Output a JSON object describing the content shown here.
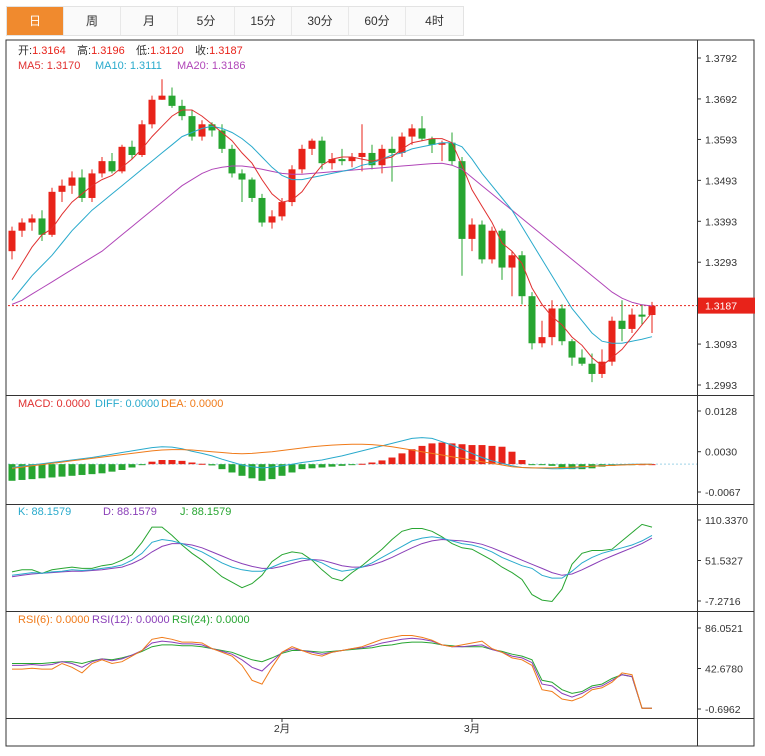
{
  "tabs": [
    {
      "label": "日",
      "active": true
    },
    {
      "label": "周"
    },
    {
      "label": "月"
    },
    {
      "label": "5分"
    },
    {
      "label": "15分"
    },
    {
      "label": "30分"
    },
    {
      "label": "60分"
    },
    {
      "label": "4时"
    }
  ],
  "colors": {
    "up": "#e8231a",
    "down": "#27a531",
    "ma5": "#e03030",
    "ma10": "#29aacc",
    "ma20": "#b045b8",
    "orange": "#f07b1a"
  },
  "main_legend": {
    "open_label": "开:",
    "open": "1.3164",
    "high_label": "高:",
    "high": "1.3196",
    "low_label": "低:",
    "low": "1.3120",
    "close_label": "收:",
    "close": "1.3187",
    "ma5": "MA5:  1.3170",
    "ma10": "MA10:  1.3111",
    "ma20": "MA20:  1.3186"
  },
  "macd_legend": {
    "macd": "MACD: 0.0000",
    "diff": "DIFF: 0.0000",
    "dea": "DEA: 0.0000"
  },
  "kdj_legend": {
    "k": "K: 88.1579",
    "d": "D: 88.1579",
    "j": "J: 88.1579"
  },
  "rsi_legend": {
    "rsi6": "RSI(6): 0.0000",
    "rsi12": "RSI(12): 0.0000",
    "rsi24": "RSI(24): 0.0000"
  },
  "price_marker": "1.3187",
  "x_labels": [
    {
      "label": "2月",
      "index": 27
    },
    {
      "label": "3月",
      "index": 46
    }
  ],
  "chart_data": [
    {
      "type": "candlestick",
      "y_ticks": [
        "1.3792",
        "1.3692",
        "1.3593",
        "1.3493",
        "1.3393",
        "1.3293",
        "1.3187",
        "1.3093",
        "1.2993"
      ],
      "ylim": [
        1.2973,
        1.3832
      ],
      "current_price": 1.3187,
      "candles": [
        [
          1.332,
          1.338,
          1.33,
          1.337
        ],
        [
          1.337,
          1.34,
          1.3355,
          1.339
        ],
        [
          1.339,
          1.341,
          1.337,
          1.34
        ],
        [
          1.34,
          1.342,
          1.3345,
          1.336
        ],
        [
          1.336,
          1.3475,
          1.3355,
          1.3465
        ],
        [
          1.3465,
          1.3495,
          1.344,
          1.348
        ],
        [
          1.348,
          1.3515,
          1.346,
          1.35
        ],
        [
          1.35,
          1.352,
          1.344,
          1.345
        ],
        [
          1.345,
          1.352,
          1.344,
          1.351
        ],
        [
          1.351,
          1.355,
          1.35,
          1.354
        ],
        [
          1.354,
          1.356,
          1.351,
          1.3515
        ],
        [
          1.3515,
          1.358,
          1.351,
          1.3575
        ],
        [
          1.3575,
          1.359,
          1.3545,
          1.3555
        ],
        [
          1.3555,
          1.364,
          1.355,
          1.363
        ],
        [
          1.363,
          1.37,
          1.362,
          1.369
        ],
        [
          1.369,
          1.374,
          1.369,
          1.37
        ],
        [
          1.37,
          1.372,
          1.367,
          1.3675
        ],
        [
          1.3675,
          1.369,
          1.364,
          1.365
        ],
        [
          1.365,
          1.3665,
          1.359,
          1.36
        ],
        [
          1.36,
          1.364,
          1.359,
          1.363
        ],
        [
          1.363,
          1.3635,
          1.36,
          1.3615
        ],
        [
          1.3615,
          1.363,
          1.356,
          1.357
        ],
        [
          1.357,
          1.358,
          1.35,
          1.351
        ],
        [
          1.351,
          1.352,
          1.344,
          1.3495
        ],
        [
          1.3495,
          1.35,
          1.344,
          1.345
        ],
        [
          1.345,
          1.346,
          1.338,
          1.339
        ],
        [
          1.339,
          1.342,
          1.3375,
          1.3405
        ],
        [
          1.3405,
          1.345,
          1.3395,
          1.344
        ],
        [
          1.344,
          1.353,
          1.343,
          1.352
        ],
        [
          1.352,
          1.358,
          1.351,
          1.357
        ],
        [
          1.357,
          1.3595,
          1.3555,
          1.359
        ],
        [
          1.359,
          1.36,
          1.352,
          1.3535
        ],
        [
          1.3535,
          1.356,
          1.352,
          1.3545
        ],
        [
          1.3545,
          1.357,
          1.353,
          1.354
        ],
        [
          1.354,
          1.356,
          1.3525,
          1.355
        ],
        [
          1.355,
          1.363,
          1.3515,
          1.356
        ],
        [
          1.356,
          1.358,
          1.352,
          1.353
        ],
        [
          1.353,
          1.358,
          1.351,
          1.357
        ],
        [
          1.357,
          1.36,
          1.349,
          1.356
        ],
        [
          1.356,
          1.361,
          1.355,
          1.36
        ],
        [
          1.36,
          1.363,
          1.358,
          1.362
        ],
        [
          1.362,
          1.365,
          1.359,
          1.3595
        ],
        [
          1.3595,
          1.36,
          1.356,
          1.358
        ],
        [
          1.358,
          1.359,
          1.354,
          1.3585
        ],
        [
          1.3585,
          1.361,
          1.353,
          1.354
        ],
        [
          1.354,
          1.355,
          1.326,
          1.335
        ],
        [
          1.335,
          1.34,
          1.332,
          1.3385
        ],
        [
          1.3385,
          1.3395,
          1.329,
          1.33
        ],
        [
          1.33,
          1.338,
          1.329,
          1.337
        ],
        [
          1.337,
          1.3375,
          1.325,
          1.328
        ],
        [
          1.328,
          1.332,
          1.321,
          1.331
        ],
        [
          1.331,
          1.332,
          1.319,
          1.321
        ],
        [
          1.321,
          1.322,
          1.308,
          1.3095
        ],
        [
          1.3095,
          1.315,
          1.3085,
          1.311
        ],
        [
          1.311,
          1.32,
          1.309,
          1.318
        ],
        [
          1.318,
          1.319,
          1.309,
          1.31
        ],
        [
          1.31,
          1.3105,
          1.304,
          1.306
        ],
        [
          1.306,
          1.308,
          1.304,
          1.3045
        ],
        [
          1.3045,
          1.307,
          1.3,
          1.302
        ],
        [
          1.302,
          1.308,
          1.301,
          1.305
        ],
        [
          1.305,
          1.316,
          1.304,
          1.315
        ],
        [
          1.315,
          1.32,
          1.31,
          1.313
        ],
        [
          1.313,
          1.318,
          1.312,
          1.3165
        ],
        [
          1.3165,
          1.319,
          1.314,
          1.316
        ],
        [
          1.3164,
          1.3196,
          1.312,
          1.3187
        ]
      ],
      "ma5": [
        1.325,
        1.329,
        1.333,
        1.336,
        1.3375,
        1.341,
        1.344,
        1.346,
        1.348,
        1.3495,
        1.3505,
        1.3525,
        1.3545,
        1.357,
        1.36,
        1.3625,
        1.365,
        1.3665,
        1.3665,
        1.365,
        1.363,
        1.361,
        1.359,
        1.356,
        1.3535,
        1.3495,
        1.346,
        1.344,
        1.3445,
        1.3465,
        1.35,
        1.353,
        1.3545,
        1.355,
        1.355,
        1.3545,
        1.354,
        1.3545,
        1.355,
        1.357,
        1.3585,
        1.359,
        1.3595,
        1.3595,
        1.3585,
        1.353,
        1.347,
        1.343,
        1.339,
        1.334,
        1.332,
        1.329,
        1.323,
        1.319,
        1.316,
        1.314,
        1.311,
        1.309,
        1.306,
        1.304,
        1.306,
        1.308,
        1.311,
        1.314,
        1.317
      ],
      "ma10": [
        1.32,
        1.323,
        1.326,
        1.3285,
        1.331,
        1.334,
        1.337,
        1.3395,
        1.342,
        1.344,
        1.346,
        1.348,
        1.35,
        1.352,
        1.354,
        1.356,
        1.358,
        1.36,
        1.361,
        1.362,
        1.3625,
        1.362,
        1.361,
        1.3595,
        1.3575,
        1.355,
        1.3525,
        1.3505,
        1.3495,
        1.3495,
        1.35,
        1.3505,
        1.351,
        1.3515,
        1.352,
        1.353,
        1.3535,
        1.3545,
        1.3555,
        1.356,
        1.357,
        1.3575,
        1.358,
        1.3585,
        1.3585,
        1.3575,
        1.3545,
        1.351,
        1.348,
        1.345,
        1.342,
        1.338,
        1.334,
        1.33,
        1.326,
        1.322,
        1.318,
        1.315,
        1.312,
        1.31,
        1.3095,
        1.3095,
        1.31,
        1.3105,
        1.3111
      ],
      "ma20": [
        1.319,
        1.32,
        1.3215,
        1.323,
        1.3245,
        1.326,
        1.3275,
        1.329,
        1.3305,
        1.332,
        1.334,
        1.336,
        1.338,
        1.34,
        1.342,
        1.344,
        1.346,
        1.348,
        1.3495,
        1.351,
        1.352,
        1.3525,
        1.3528,
        1.3528,
        1.3525,
        1.352,
        1.3515,
        1.351,
        1.3508,
        1.3508,
        1.351,
        1.3512,
        1.3514,
        1.3516,
        1.3518,
        1.352,
        1.3522,
        1.3524,
        1.3526,
        1.3528,
        1.353,
        1.3532,
        1.3534,
        1.3535,
        1.353,
        1.352,
        1.35,
        1.348,
        1.346,
        1.344,
        1.342,
        1.34,
        1.338,
        1.336,
        1.334,
        1.332,
        1.33,
        1.328,
        1.326,
        1.324,
        1.322,
        1.3205,
        1.3195,
        1.3189,
        1.3186
      ]
    },
    {
      "type": "macd",
      "y_ticks": [
        "0.0128",
        "0.0030",
        "-0.0067"
      ],
      "ylim": [
        -0.0075,
        0.0135
      ],
      "macd": [
        -0.004,
        -0.0038,
        -0.0036,
        -0.0034,
        -0.0032,
        -0.003,
        -0.0028,
        -0.0026,
        -0.0024,
        -0.0022,
        -0.0018,
        -0.0014,
        -0.0008,
        -0.0002,
        0.0006,
        0.001,
        0.001,
        0.0008,
        0.0004,
        0.0001,
        -0.0003,
        -0.0012,
        -0.002,
        -0.0028,
        -0.0034,
        -0.004,
        -0.0036,
        -0.0028,
        -0.002,
        -0.0012,
        -0.001,
        -0.0008,
        -0.0006,
        -0.0004,
        -0.0002,
        0.0001,
        0.0004,
        0.0009,
        0.0016,
        0.0026,
        0.0036,
        0.0044,
        0.005,
        0.0052,
        0.005,
        0.0048,
        0.0046,
        0.0046,
        0.0044,
        0.0042,
        0.003,
        0.001,
        -0.0001,
        -0.0002,
        -0.0004,
        -0.001,
        -0.0012,
        -0.0012,
        -0.001,
        -0.0006,
        -0.0004,
        -0.0002,
        -0.0001,
        0.0,
        0.0
      ],
      "diff": [
        -0.0008,
        -0.0005,
        -0.0002,
        0.0001,
        0.0004,
        0.0007,
        0.001,
        0.0013,
        0.0016,
        0.002,
        0.0024,
        0.0028,
        0.0032,
        0.0036,
        0.004,
        0.0042,
        0.0041,
        0.0037,
        0.0031,
        0.0026,
        0.002,
        0.0012,
        0.0005,
        -0.0002,
        -0.0006,
        -0.0009,
        -0.0007,
        -0.0004,
        0.0,
        0.0004,
        0.0007,
        0.001,
        0.0015,
        0.002,
        0.0026,
        0.0032,
        0.0038,
        0.0044,
        0.005,
        0.0056,
        0.0062,
        0.0064,
        0.0062,
        0.0054,
        0.0046,
        0.0036,
        0.0026,
        0.0016,
        0.0008,
        0.0002,
        -0.0004,
        -0.0008,
        -0.0009,
        -0.001,
        -0.0011,
        -0.0011,
        -0.001,
        -0.0008,
        -0.0005,
        -0.0003,
        -0.0002,
        -0.0001,
        0.0,
        0.0,
        0.0
      ],
      "dea": [
        -0.001,
        -0.0007,
        -0.0004,
        -0.0001,
        0.0002,
        0.0005,
        0.0008,
        0.0011,
        0.0014,
        0.0017,
        0.002,
        0.0023,
        0.0026,
        0.0029,
        0.0032,
        0.0034,
        0.0035,
        0.0035,
        0.0034,
        0.0032,
        0.003,
        0.0028,
        0.0026,
        0.0025,
        0.0026,
        0.0028,
        0.003,
        0.0033,
        0.0036,
        0.0039,
        0.0042,
        0.0044,
        0.0046,
        0.0047,
        0.0048,
        0.0048,
        0.0047,
        0.0045,
        0.0042,
        0.0038,
        0.0034,
        0.003,
        0.0026,
        0.0022,
        0.0018,
        0.0014,
        0.001,
        0.0006,
        0.0002,
        -0.0002,
        -0.0006,
        -0.0008,
        -0.0009,
        -0.0009,
        -0.0009,
        -0.0008,
        -0.0007,
        -0.0006,
        -0.0005,
        -0.0004,
        -0.0003,
        -0.0002,
        -0.0001,
        0.0,
        0.0
      ]
    },
    {
      "type": "kdj",
      "y_ticks": [
        "110.3370",
        "51.5327",
        "-7.2716"
      ],
      "ylim": [
        -12,
        116
      ],
      "k": [
        30,
        32,
        34,
        33,
        35,
        36,
        38,
        37,
        38,
        40,
        42,
        45,
        52,
        62,
        78,
        82,
        80,
        76,
        70,
        64,
        56,
        48,
        42,
        38,
        36,
        36,
        42,
        48,
        52,
        55,
        53,
        48,
        40,
        36,
        38,
        42,
        48,
        56,
        64,
        72,
        80,
        84,
        86,
        84,
        80,
        76,
        74,
        70,
        64,
        56,
        50,
        44,
        40,
        30,
        26,
        26,
        36,
        48,
        56,
        62,
        66,
        70,
        74,
        80,
        88
      ],
      "d": [
        28,
        30,
        32,
        33,
        34,
        35,
        36,
        36,
        37,
        38,
        40,
        42,
        47,
        54,
        64,
        72,
        76,
        76,
        74,
        70,
        64,
        58,
        52,
        47,
        43,
        40,
        40,
        43,
        47,
        51,
        53,
        52,
        48,
        44,
        42,
        42,
        45,
        50,
        56,
        63,
        70,
        76,
        80,
        82,
        81,
        80,
        78,
        75,
        70,
        64,
        58,
        52,
        46,
        40,
        34,
        30,
        32,
        38,
        45,
        52,
        58,
        64,
        70,
        76,
        84
      ],
      "j": [
        35,
        38,
        38,
        33,
        38,
        40,
        42,
        40,
        40,
        44,
        46,
        52,
        60,
        78,
        100,
        100,
        88,
        74,
        62,
        52,
        40,
        28,
        20,
        12,
        18,
        30,
        50,
        60,
        64,
        62,
        52,
        38,
        26,
        22,
        34,
        44,
        56,
        68,
        82,
        94,
        98,
        98,
        94,
        86,
        76,
        70,
        68,
        60,
        52,
        42,
        34,
        24,
        2,
        -6,
        -8,
        10,
        46,
        62,
        66,
        66,
        68,
        80,
        92,
        104,
        100
      ]
    },
    {
      "type": "rsi",
      "y_ticks": [
        "86.0521",
        "42.6780",
        "-0.6962"
      ],
      "ylim": [
        -3,
        90
      ],
      "rsi6": [
        42,
        42,
        43,
        42,
        42,
        48,
        44,
        38,
        48,
        52,
        48,
        50,
        56,
        62,
        74,
        76,
        74,
        71,
        71,
        70,
        64,
        60,
        56,
        46,
        30,
        26,
        44,
        60,
        66,
        62,
        58,
        56,
        60,
        62,
        64,
        66,
        70,
        74,
        76,
        78,
        78,
        76,
        73,
        68,
        66,
        68,
        70,
        72,
        64,
        60,
        54,
        52,
        46,
        20,
        18,
        10,
        8,
        12,
        20,
        22,
        28,
        38,
        36,
        0,
        0
      ],
      "rsi12": [
        46,
        46,
        47,
        46,
        47,
        50,
        48,
        44,
        50,
        53,
        51,
        53,
        57,
        62,
        70,
        72,
        71,
        69,
        69,
        68,
        64,
        61,
        58,
        52,
        44,
        40,
        50,
        60,
        64,
        62,
        60,
        58,
        60,
        62,
        64,
        65,
        67,
        70,
        72,
        74,
        75,
        74,
        72,
        68,
        66,
        66,
        67,
        68,
        63,
        60,
        56,
        54,
        49,
        26,
        24,
        16,
        12,
        16,
        22,
        24,
        30,
        36,
        34,
        0,
        0
      ],
      "rsi24": [
        48,
        48,
        48,
        48,
        49,
        50,
        50,
        48,
        51,
        53,
        52,
        54,
        57,
        61,
        66,
        68,
        68,
        67,
        67,
        66,
        64,
        62,
        60,
        56,
        52,
        50,
        54,
        59,
        62,
        62,
        61,
        60,
        61,
        62,
        63,
        64,
        65,
        67,
        68,
        70,
        71,
        71,
        70,
        68,
        67,
        66,
        66,
        66,
        63,
        61,
        58,
        56,
        52,
        30,
        28,
        20,
        16,
        18,
        24,
        26,
        32,
        36,
        34,
        0,
        0
      ]
    }
  ]
}
